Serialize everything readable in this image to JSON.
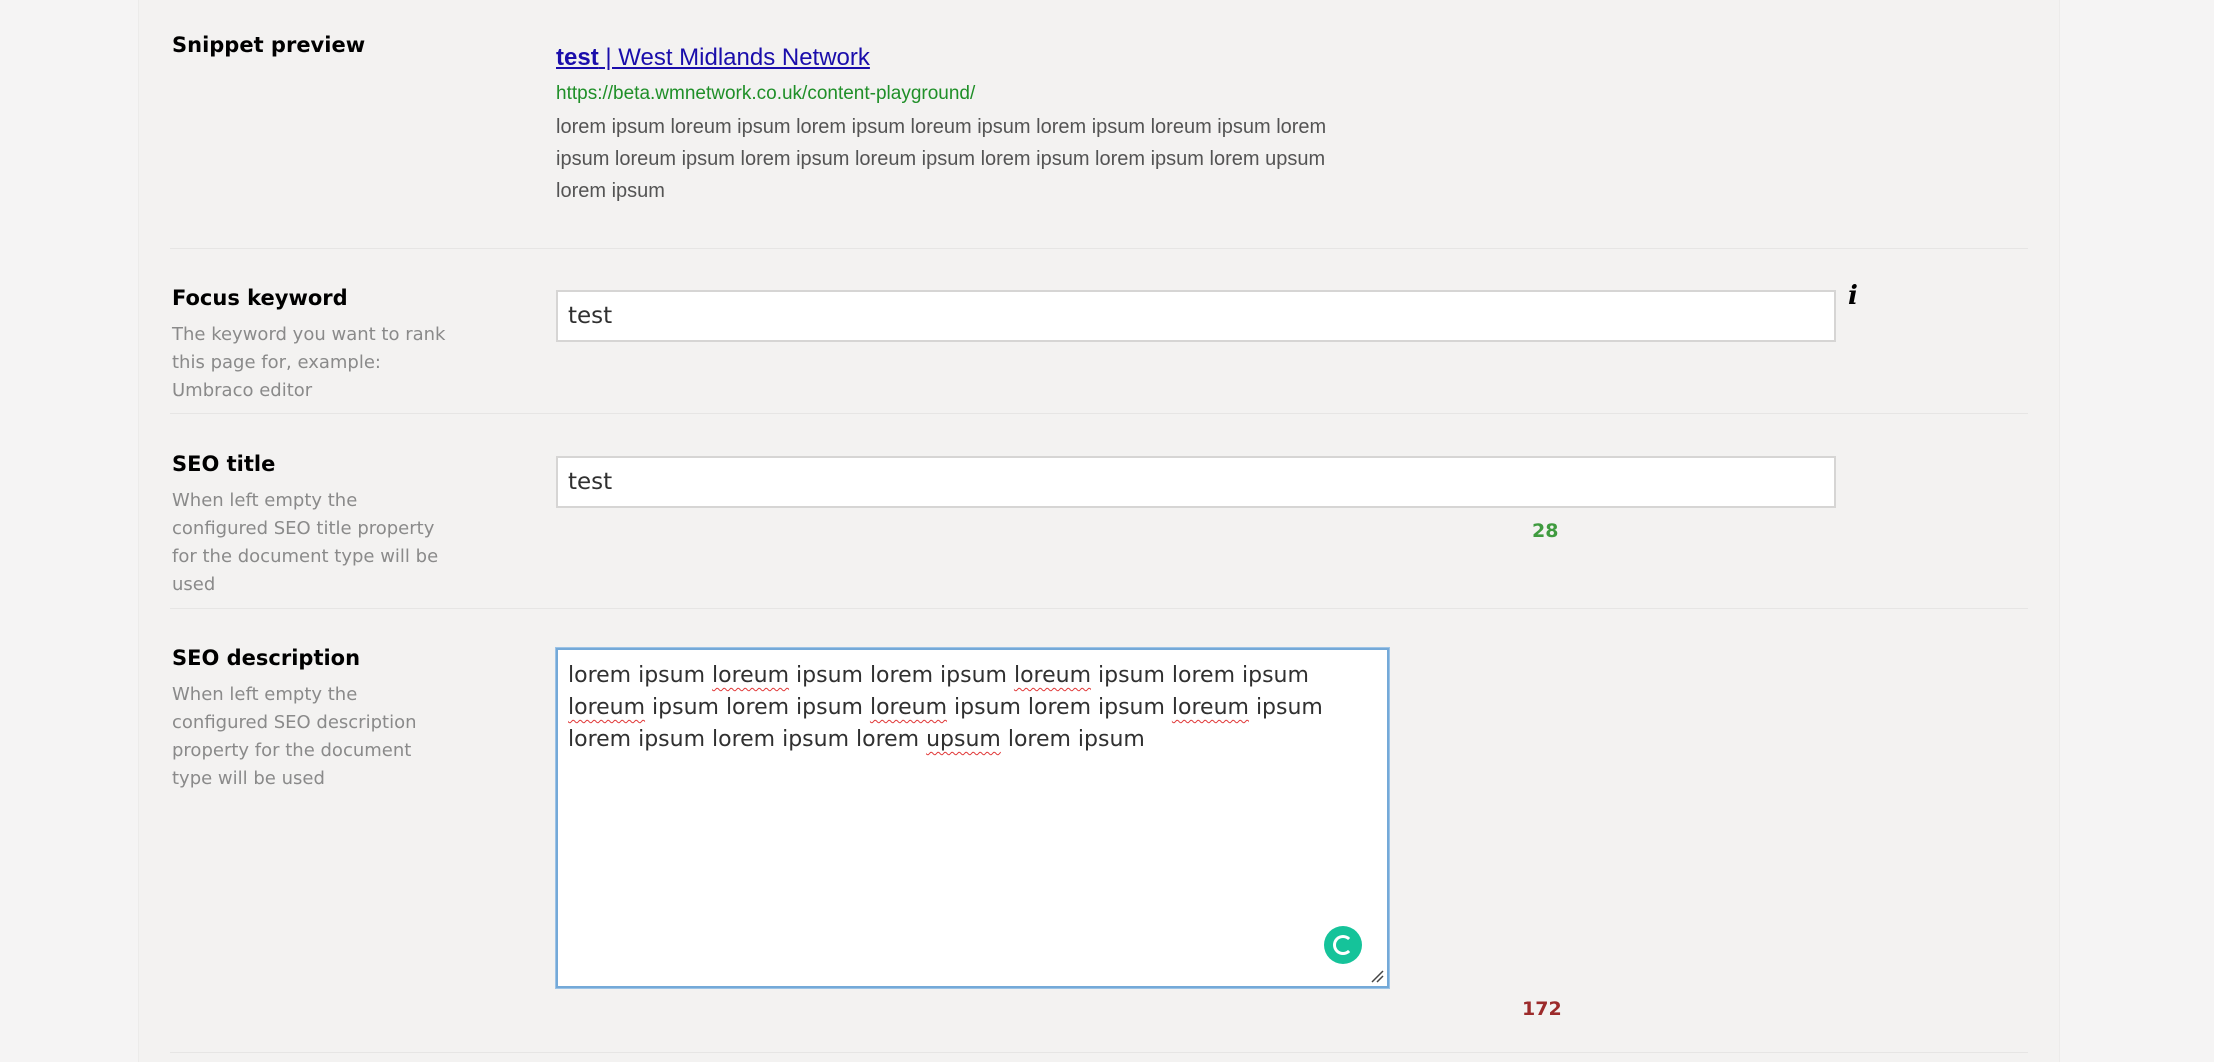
{
  "snippet_preview": {
    "label": "Snippet preview",
    "title_keyword": "test",
    "title_rest": " | West Midlands Network",
    "url": "https://beta.wmnetwork.co.uk/content-playground/",
    "description": "lorem ipsum loreum ipsum lorem ipsum loreum ipsum lorem ipsum loreum ipsum lorem ipsum loreum ipsum lorem ipsum loreum ipsum lorem ipsum lorem ipsum lorem upsum lorem ipsum"
  },
  "focus_keyword": {
    "label": "Focus keyword",
    "description": "The keyword you want to rank this page for, example: Umbraco editor",
    "value": "test",
    "info_icon": "info-icon"
  },
  "seo_title": {
    "label": "SEO title",
    "description": "When left empty the configured SEO title property for the document type will be used",
    "value": "test",
    "counter": "28",
    "counter_color": "#3f9b3f"
  },
  "seo_description": {
    "label": "SEO description",
    "description": "When left empty the configured SEO description property for the document type will be used",
    "text_parts": [
      {
        "t": "lorem ipsum ",
        "s": false
      },
      {
        "t": "loreum",
        "s": true
      },
      {
        "t": " ipsum lorem ipsum ",
        "s": false
      },
      {
        "t": "loreum",
        "s": true
      },
      {
        "t": " ipsum lorem ipsum ",
        "s": false
      },
      {
        "t": "loreum",
        "s": true
      },
      {
        "t": " ipsum lorem ipsum ",
        "s": false
      },
      {
        "t": "loreum",
        "s": true
      },
      {
        "t": " ipsum lorem ipsum ",
        "s": false
      },
      {
        "t": "loreum",
        "s": true
      },
      {
        "t": " ipsum lorem ipsum lorem ipsum lorem ",
        "s": false
      },
      {
        "t": "upsum",
        "s": true
      },
      {
        "t": " lorem ipsum",
        "s": false
      }
    ],
    "counter": "172",
    "counter_color": "#9c2b2b",
    "assistant_icon": "grammarly-icon"
  }
}
